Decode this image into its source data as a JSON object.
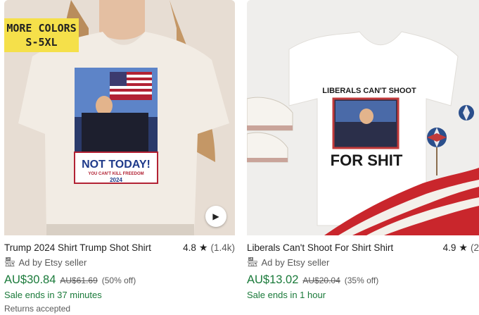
{
  "listings": [
    {
      "badge_line1": "MORE COLORS",
      "badge_line2": "S-5XL",
      "shirt_headline": "NOT TODAY!",
      "shirt_subline": "YOU CAN'T KILL FREEDOM",
      "shirt_year": "2024",
      "play_icon": "play-icon",
      "title": "Trump 2024 Shirt Trump Shot Shirt",
      "rating": "4.8",
      "reviews": "(1.4k)",
      "ad_text": "Ad by Etsy seller",
      "price": "AU$30.84",
      "original_price": "AU$61.69",
      "discount": "(50% off)",
      "sale_text": "Sale ends in 37 minutes",
      "returns_text": "Returns accepted"
    },
    {
      "shirt_line1": "LIBERALS CAN'T SHOOT",
      "shirt_line2": "FOR SHIT",
      "title": "Liberals Can't Shoot For Shirt Shirt",
      "rating": "4.9",
      "reviews": "(2",
      "ad_text": "Ad by Etsy seller",
      "price": "AU$13.02",
      "original_price": "AU$20.04",
      "discount": "(35% off)",
      "sale_text": "Sale ends in 1 hour"
    }
  ],
  "colors": {
    "price_green": "#1a7a3a",
    "badge_yellow": "#f5e04a",
    "muted_text": "#595959"
  }
}
